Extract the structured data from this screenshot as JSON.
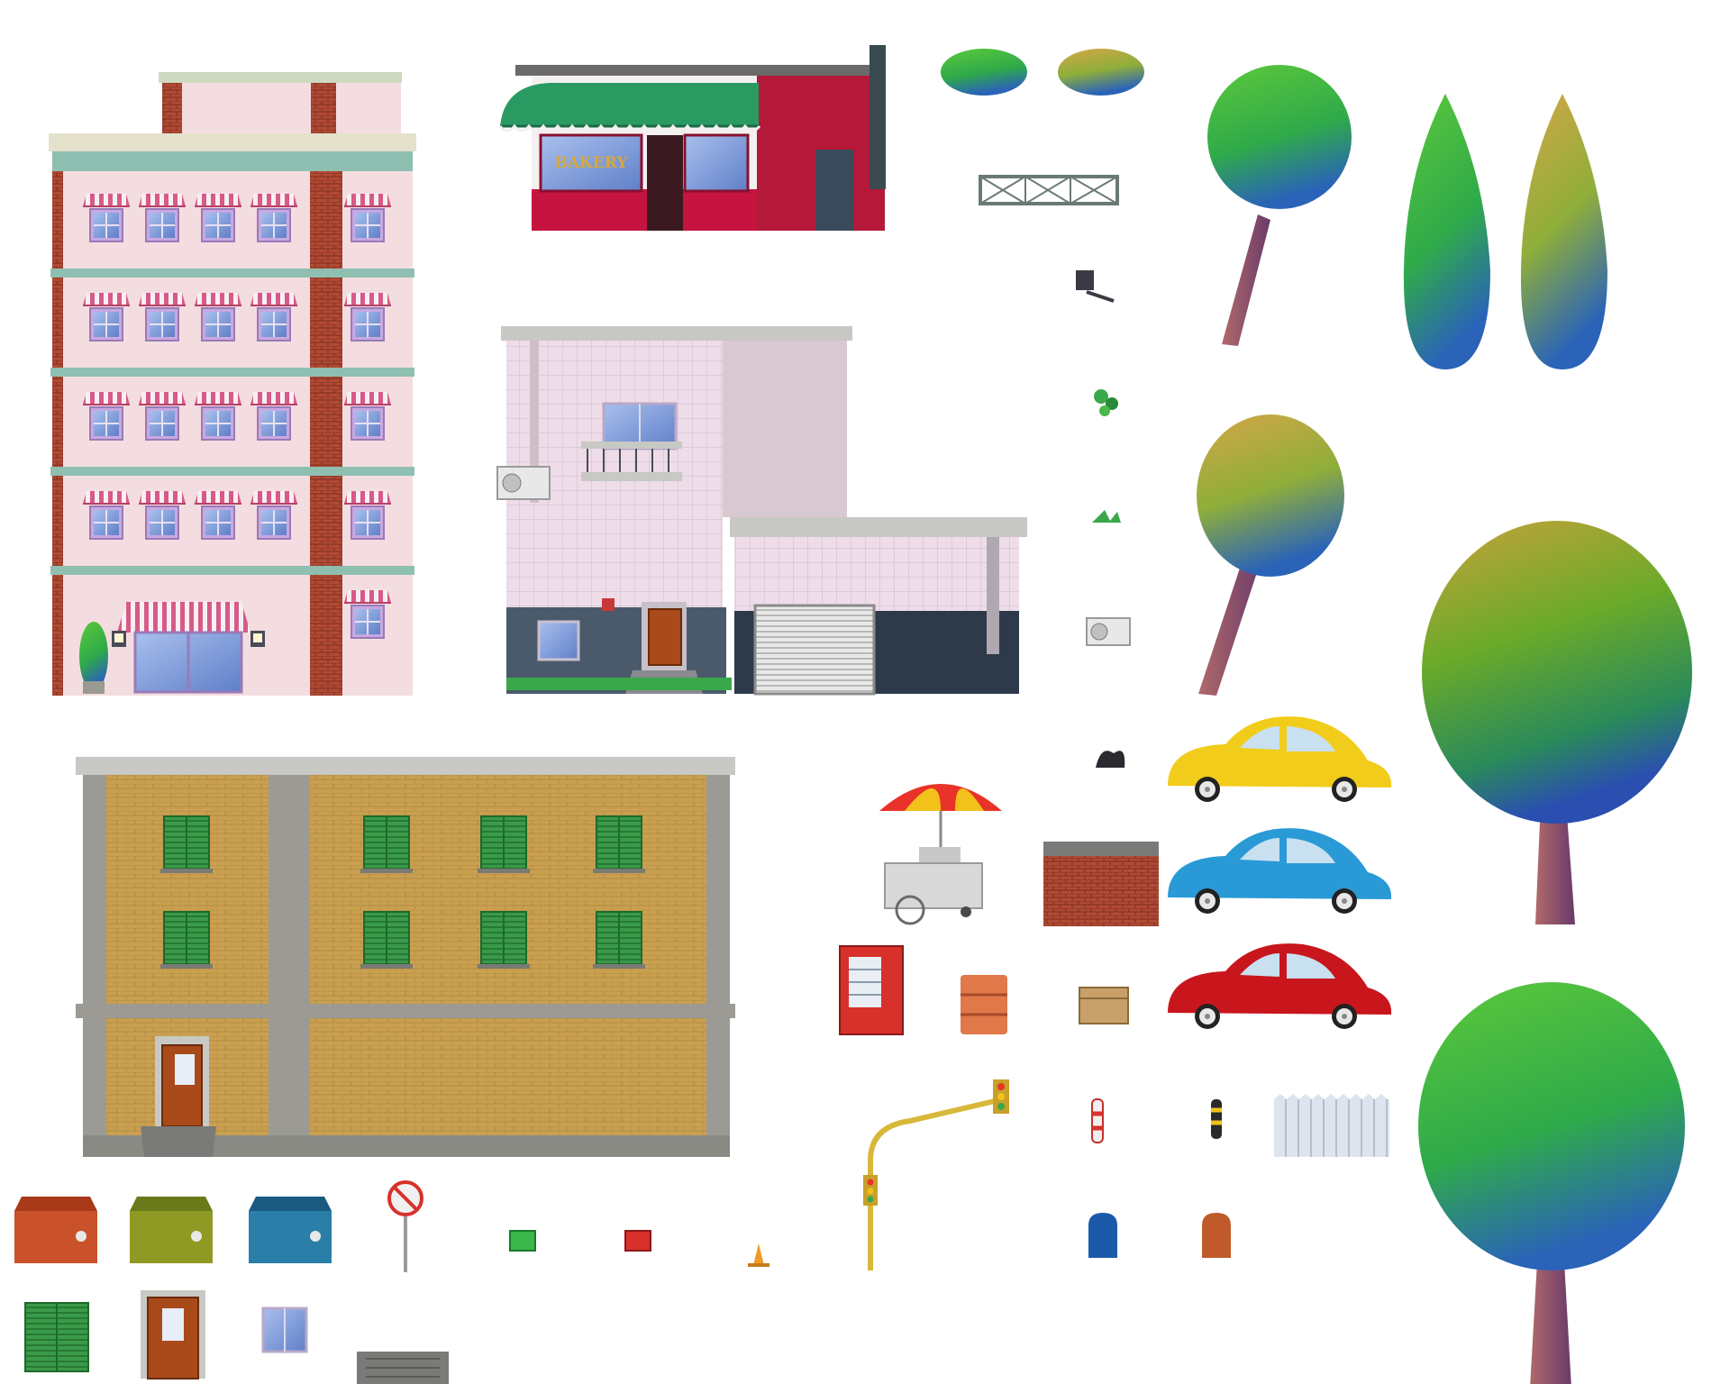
{
  "sheet": {
    "background": "#ffffff",
    "sprite_count": 46
  },
  "bakery": {
    "sign_text": "BAKERY",
    "awning_color": "#2a9a63",
    "facade_color": "#c4143f"
  },
  "palette": {
    "brick": "#b04a34",
    "pink_wall": "#f4dde0",
    "cornice_green": "#8fbfb0",
    "tile_pink": "#eedde8",
    "ochre": "#c9a050",
    "stone": "#9b9a94",
    "shutter_green": "#3a9a4a",
    "window_glass": "#7f9fd8",
    "trunk": "#8a4a5a",
    "leaf_green": "#3fb33a",
    "leaf_autumn": "#c9a24a",
    "leaf_blue": "#2d6fb8"
  },
  "cars": [
    {
      "name": "yellow-beetle",
      "color": "#f2cc1a"
    },
    {
      "name": "blue-beetle",
      "color": "#2a9ad6"
    },
    {
      "name": "red-beetle",
      "color": "#c8161c"
    }
  ],
  "dumpsters": [
    {
      "name": "orange",
      "color": "#c9522a"
    },
    {
      "name": "olive",
      "color": "#8f9a24"
    },
    {
      "name": "blue",
      "color": "#2a7fa8"
    }
  ],
  "icons": {
    "no_parking": "no-parking-sign",
    "traffic_light": "traffic-light",
    "wall_lamp": "wall-lamp",
    "air_conditioner": "ac-unit",
    "trash_bag": "trash-bag",
    "vending_machine": "vending-machine",
    "barrel": "oil-barrel",
    "box": "cardboard-box",
    "mailbox": "mailbox",
    "cone": "traffic-cone",
    "bollard": "bollard"
  }
}
